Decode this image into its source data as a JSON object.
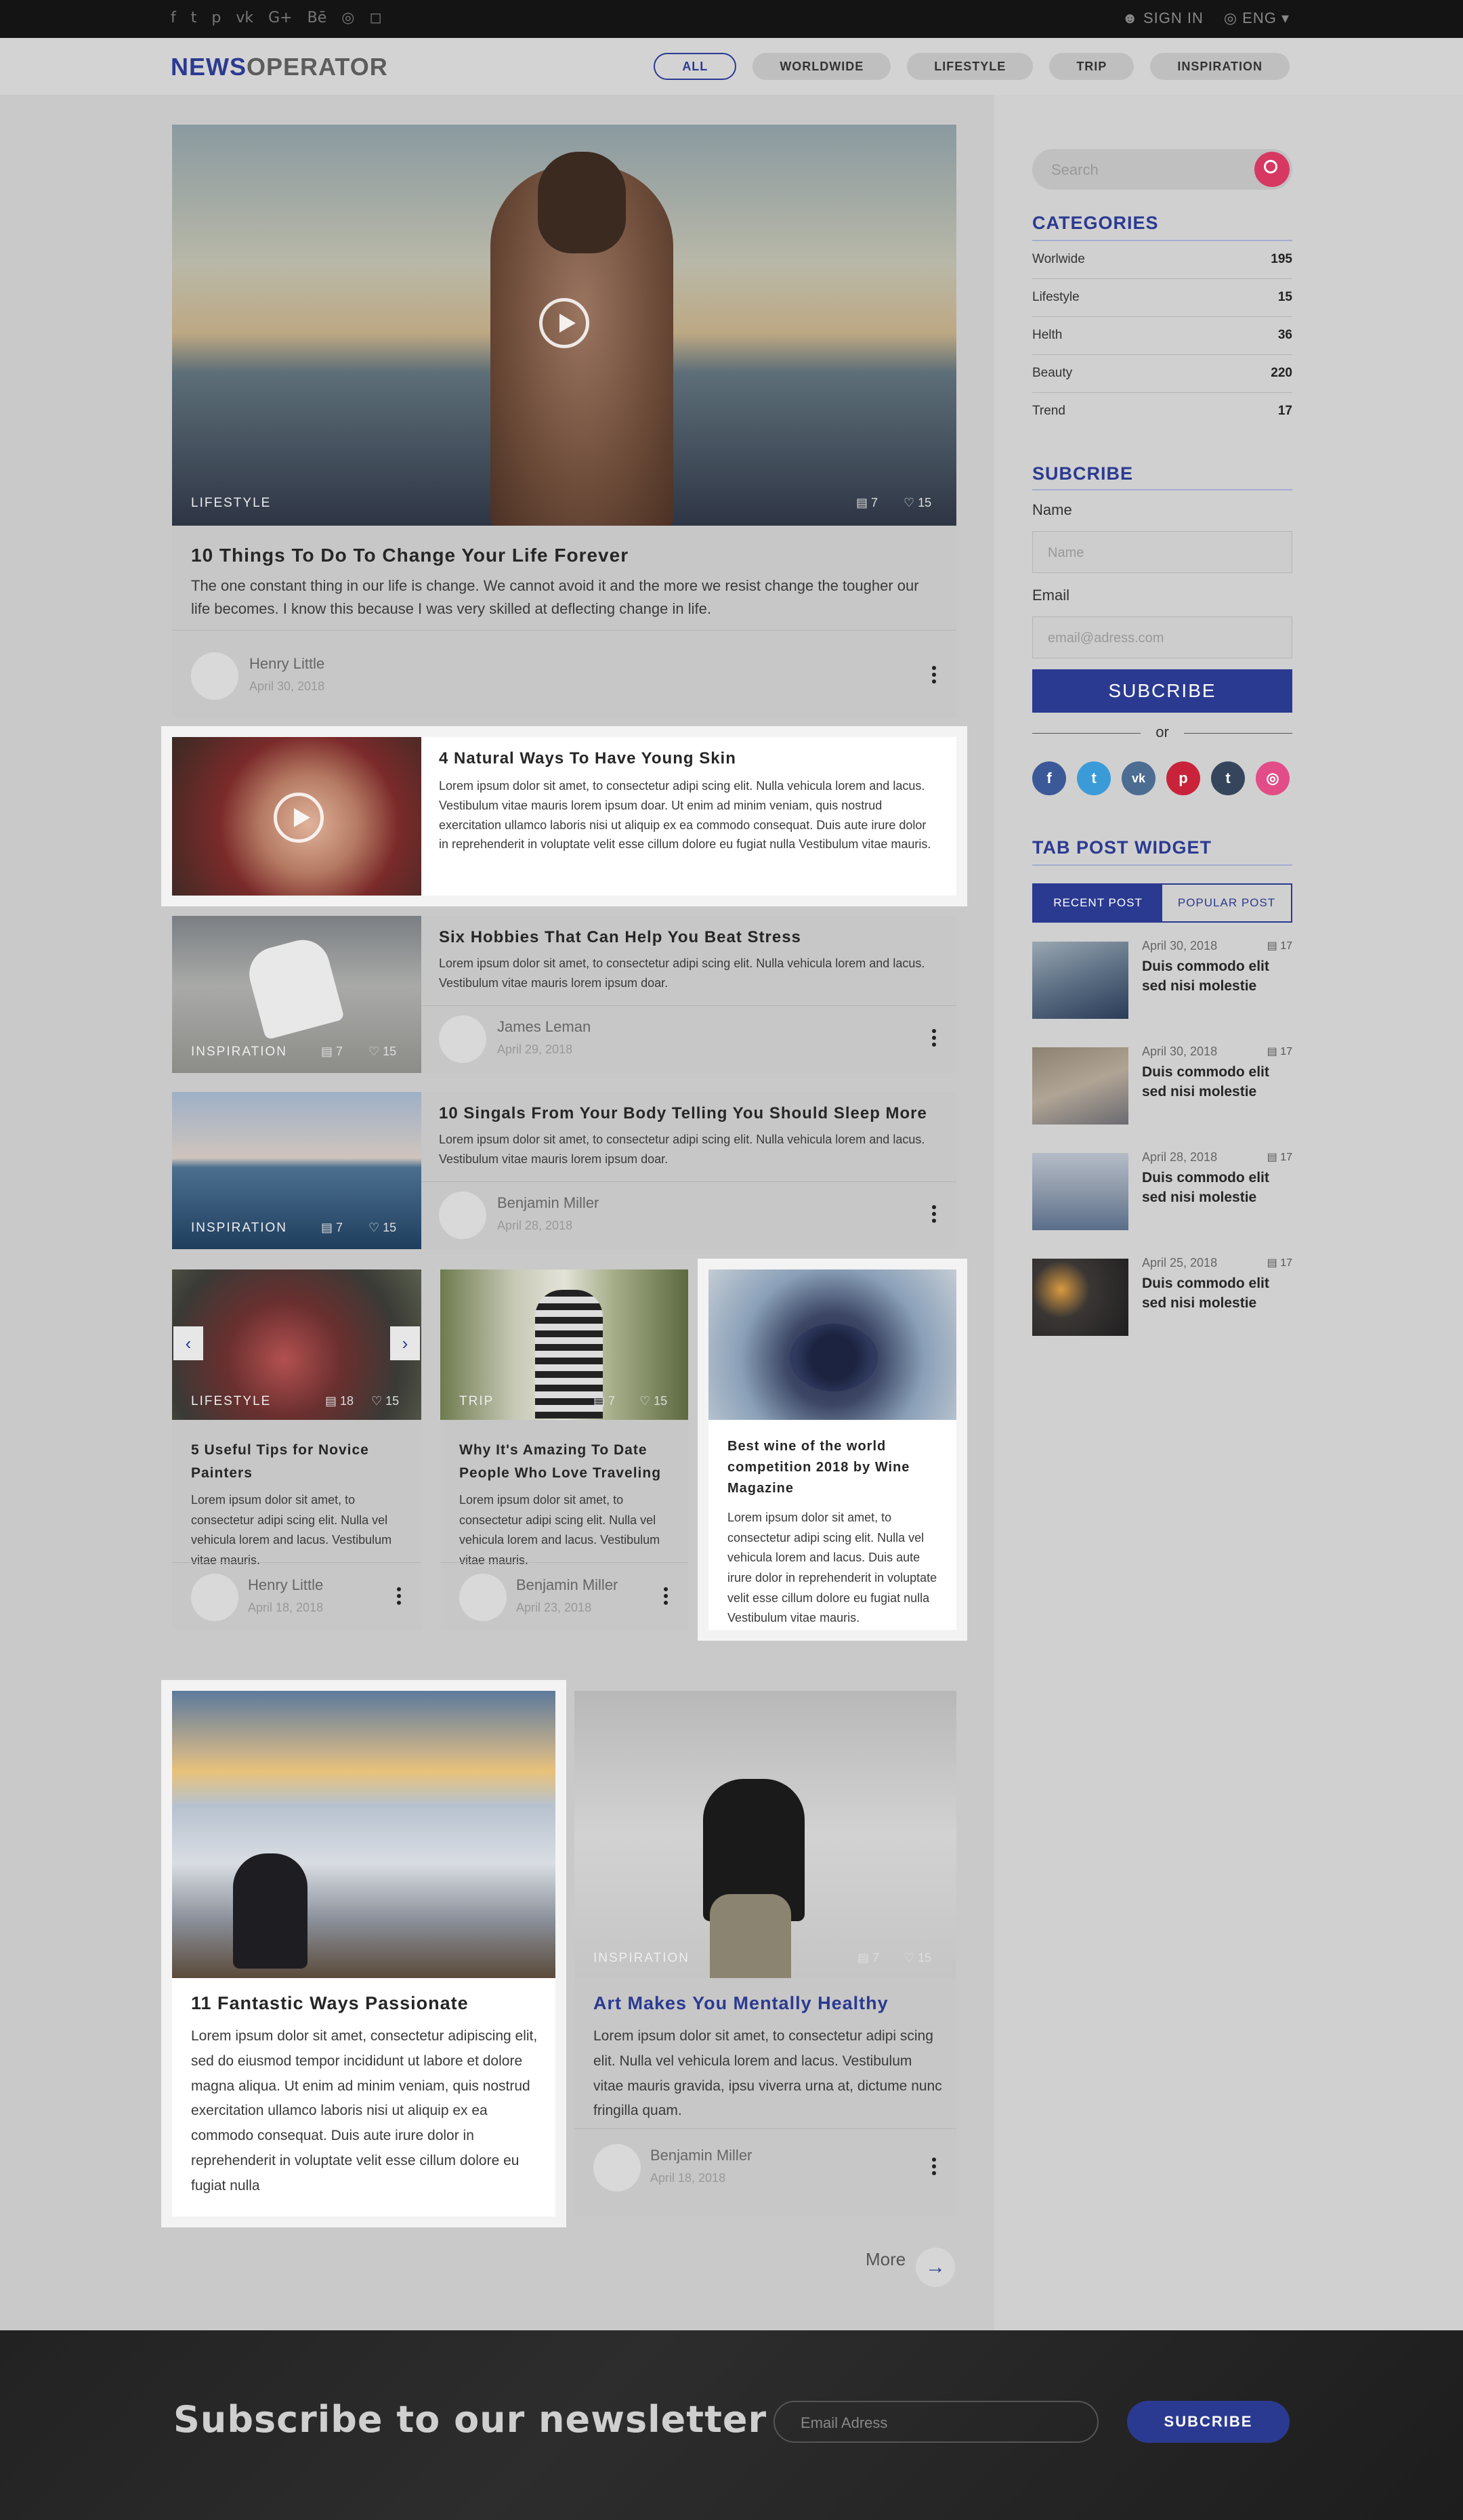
{
  "topbar": {
    "social": [
      "f",
      "t",
      "p",
      "vk",
      "G+",
      "Bē",
      "◎",
      "◻"
    ],
    "signin": "SIGN IN",
    "language": "ENG"
  },
  "header": {
    "logo_bold": "NEWS",
    "logo_rest": "OPERATOR",
    "nav": [
      "ALL",
      "WORLDWIDE",
      "LIFESTYLE",
      "TRIP",
      "INSPIRATION"
    ]
  },
  "featured": {
    "tag": "LIFESTYLE",
    "comments": "7",
    "likes": "15",
    "title": "10 Things To Do To Change Your Life Forever",
    "desc": "The one constant thing in our life is change. We cannot avoid it and the more we resist change the tougher our life becomes. I know this because I was very skilled at deflecting change in life.",
    "author": "Henry Little",
    "date": "April 30, 2018"
  },
  "list_posts": [
    {
      "title": "4 Natural Ways To Have Young Skin",
      "desc": "Lorem ipsum dolor sit amet, to consectetur  adipi scing elit. Nulla vehicula lorem and lacus. Vestibulum vitae mauris lorem ipsum doar. Ut enim ad minim veniam, quis nostrud exercitation ullamco laboris nisi ut aliquip ex ea commodo consequat. Duis aute irure dolor in reprehenderit in voluptate velit esse cillum dolore eu fugiat nulla  Vestibulum vitae mauris."
    },
    {
      "title": "Six Hobbies That Can Help You Beat Stress",
      "desc": "Lorem ipsum dolor sit amet, to consectetur  adipi scing elit. Nulla vehicula lorem and lacus. Vestibulum vitae mauris lorem ipsum doar.",
      "tag": "INSPIRATION",
      "comments": "7",
      "likes": "15",
      "author": "James Leman",
      "date": "April 29, 2018"
    },
    {
      "title": "10 Singals From Your Body Telling You Should Sleep More",
      "desc": "Lorem ipsum dolor sit amet, to consectetur  adipi scing elit. Nulla vehicula lorem and lacus. Vestibulum vitae mauris lorem ipsum doar.",
      "tag": "INSPIRATION",
      "comments": "7",
      "likes": "15",
      "author": "Benjamin Miller",
      "date": "April 28, 2018"
    }
  ],
  "grid3": [
    {
      "tag": "LIFESTYLE",
      "comments": "18",
      "likes": "15",
      "title": "5 Useful Tips for Novice Painters",
      "desc": "Lorem ipsum dolor sit amet, to consectetur  adipi scing elit. Nulla vel vehicula lorem and lacus. Vestibulum vitae mauris.",
      "author": "Henry Little",
      "date": "April 18, 2018"
    },
    {
      "tag": "TRIP",
      "comments": "7",
      "likes": "15",
      "title": "Why It's Amazing To Date People Who Love Traveling",
      "desc": "Lorem ipsum dolor sit amet, to consectetur  adipi scing elit. Nulla vel vehicula lorem and lacus. Vestibulum vitae mauris.",
      "author": "Benjamin Miller",
      "date": "April 23, 2018"
    },
    {
      "title": "Best wine of the world competition 2018 by Wine Magazine",
      "desc": "Lorem ipsum dolor sit amet, to consectetur  adipi scing elit. Nulla vel vehicula lorem and lacus. Duis aute irure dolor in reprehenderit in voluptate velit esse cillum dolore eu fugiat nulla  Vestibulum vitae mauris."
    }
  ],
  "grid2": [
    {
      "title": "11 Fantastic Ways Passionate",
      "desc": "Lorem ipsum dolor sit amet, consectetur adipiscing elit, sed do eiusmod tempor incididunt ut labore et dolore magna aliqua. Ut enim ad minim veniam, quis nostrud exercitation ullamco laboris nisi ut aliquip ex ea commodo consequat. Duis aute irure dolor in reprehenderit in voluptate velit esse cillum dolore eu fugiat nulla"
    },
    {
      "tag": "INSPIRATION",
      "comments": "7",
      "likes": "15",
      "title": "Art Makes You Mentally Healthy",
      "desc": "Lorem ipsum dolor sit amet, to consectetur  adipi scing elit. Nulla vel vehicula lorem and lacus. Vestibulum vitae mauris gravida, ipsu viverra urna at, dictume nunc fringilla quam.",
      "author": "Benjamin Miller",
      "date": "April 18, 2018"
    }
  ],
  "more_label": "More",
  "sidebar": {
    "search_placeholder": "Search",
    "categories_title": "CATEGORIES",
    "categories": [
      {
        "name": "Worlwide",
        "count": "195"
      },
      {
        "name": "Lifestyle",
        "count": "15"
      },
      {
        "name": "Helth",
        "count": "36"
      },
      {
        "name": "Beauty",
        "count": "220"
      },
      {
        "name": "Trend",
        "count": "17"
      }
    ],
    "subscribe_title": "SUBCRIBE",
    "name_label": "Name",
    "name_placeholder": "Name",
    "email_label": "Email",
    "email_placeholder": "email@adress.com",
    "subscribe_button": "SUBCRIBE",
    "or": "or",
    "social": [
      {
        "icon": "f",
        "color": "#3b5998"
      },
      {
        "icon": "t",
        "color": "#3b9bd8"
      },
      {
        "icon": "vk",
        "color": "#4c6c91"
      },
      {
        "icon": "p",
        "color": "#c8233a"
      },
      {
        "icon": "t",
        "color": "#35465c"
      },
      {
        "icon": "◎",
        "color": "#e24c87"
      }
    ],
    "tab_widget_title": "TAB POST WIDGET",
    "tabs": [
      "RECENT POST",
      "POPULAR POST"
    ],
    "tab_posts": [
      {
        "date": "April 30, 2018",
        "count": "17",
        "title": "Duis commodo elit sed nisi molestie"
      },
      {
        "date": "April 30, 2018",
        "count": "17",
        "title": "Duis commodo elit sed nisi molestie"
      },
      {
        "date": "April 28, 2018",
        "count": "17",
        "title": "Duis commodo elit sed nisi molestie"
      },
      {
        "date": "April 25, 2018",
        "count": "17",
        "title": "Duis commodo elit sed nisi molestie"
      }
    ]
  },
  "footer": {
    "heading": "Subscribe to our newsletter",
    "email_placeholder": "Email Adress",
    "button": "SUBCRIBE"
  }
}
